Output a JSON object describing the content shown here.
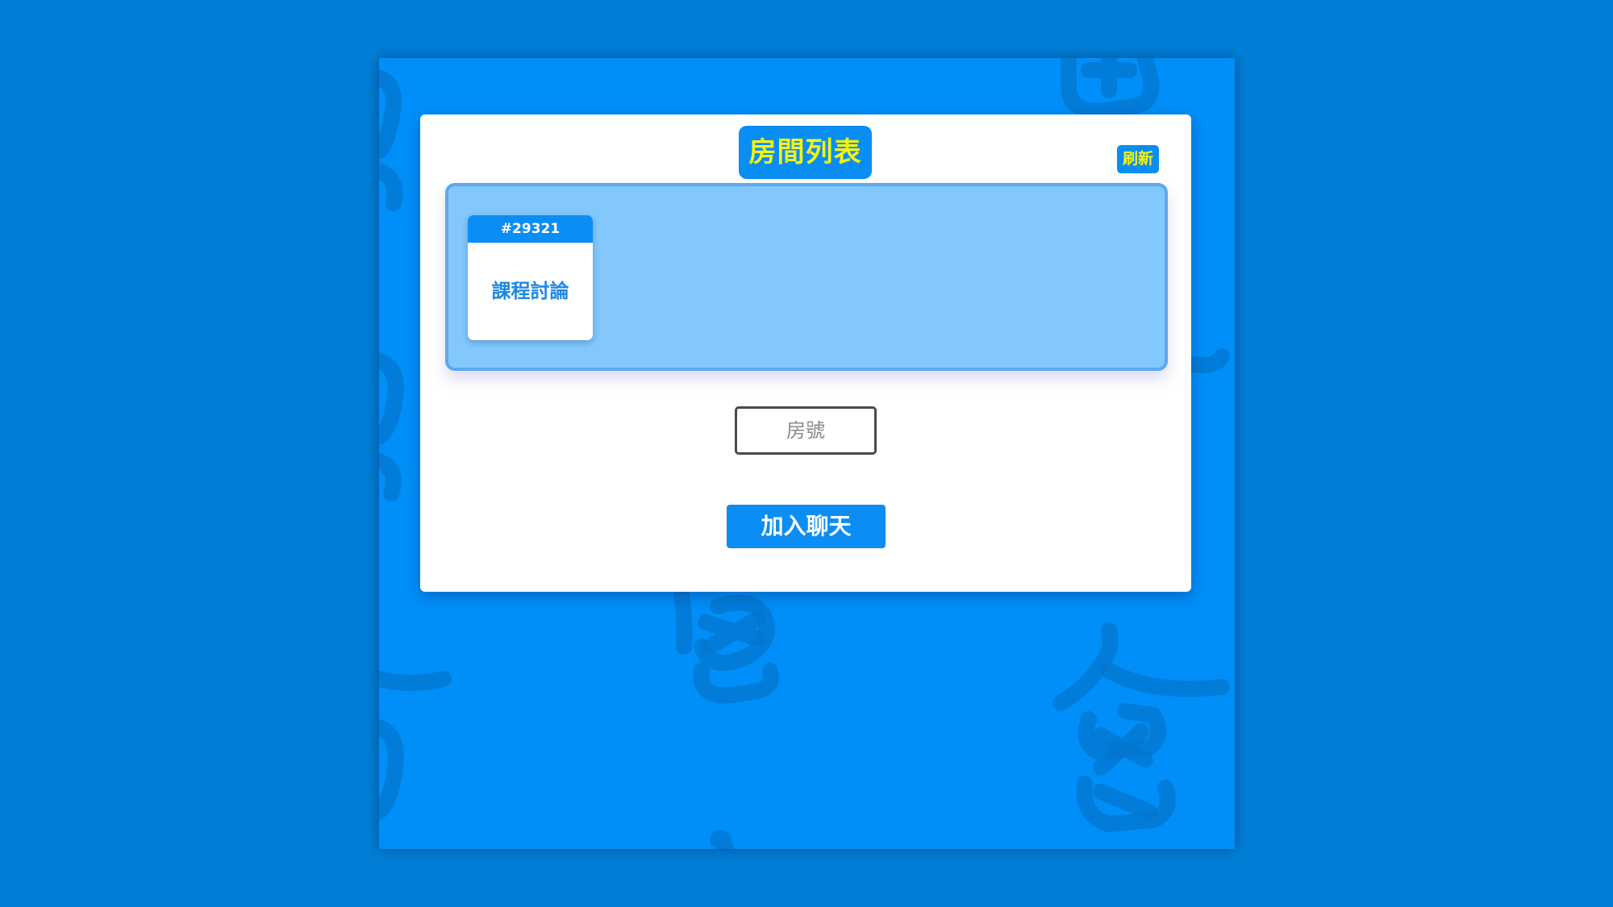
{
  "panel": {
    "title": "房間列表",
    "refresh_label": "刷新"
  },
  "rooms": [
    {
      "id": "#29321",
      "name": "課程討論"
    }
  ],
  "join_form": {
    "room_input_placeholder": "房號",
    "room_input_value": "",
    "join_label": "加入聊天"
  },
  "colors": {
    "page_background": "#007fd7",
    "app_background": "#008ff8",
    "accent": "#0a8ef5",
    "title_text": "#f7f40a",
    "room_list_background": "#82c8fc"
  }
}
